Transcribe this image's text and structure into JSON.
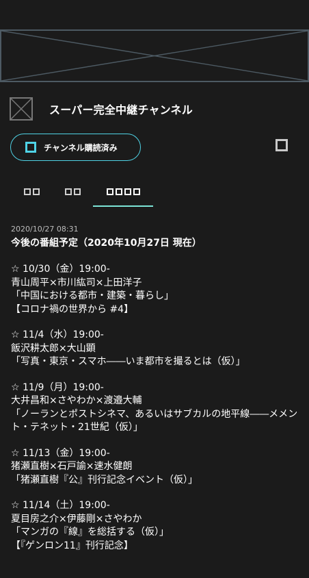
{
  "banner": {
    "icon": "placeholder-image-icon"
  },
  "channel": {
    "name": "スーパー完全中継チャンネル",
    "thumb_icon": "placeholder-image-icon"
  },
  "subscribe": {
    "label": "チャンネル購読済み",
    "icon": "checkbox-icon",
    "accent_color": "#4fd3e6"
  },
  "share": {
    "icon": "square-icon"
  },
  "tabs": [
    {
      "label": "□□",
      "active": false
    },
    {
      "label": "□□",
      "active": false
    },
    {
      "label": "□□□□",
      "active": true
    }
  ],
  "post": {
    "date": "2020/10/27 08:31",
    "heading": "今後の番組予定（2020年10月27日 現在）",
    "events": [
      {
        "lines": [
          "☆ 10/30（金）19:00-",
          "青山周平×市川紘司×上田洋子",
          "「中国における都市・建築・暮らし」",
          "【コロナ禍の世界から #4】"
        ]
      },
      {
        "lines": [
          "☆ 11/4（水）19:00-",
          "飯沢耕太郎×大山顕",
          "「写真・東京・スマホ――いま都市を撮るとは（仮）」"
        ]
      },
      {
        "lines": [
          "☆ 11/9（月）19:00-",
          "大井昌和×さやわか×渡邉大輔",
          "「ノーランとポストシネマ、あるいはサブカルの地平線――メメント・テネット・21世紀（仮）」"
        ]
      },
      {
        "lines": [
          "☆ 11/13（金）19:00-",
          "猪瀬直樹×石戸諭×速水健朗",
          "「猪瀬直樹『公』刊行記念イベント（仮）」"
        ]
      },
      {
        "lines": [
          "☆ 11/14（土）19:00-",
          "夏目房之介×伊藤剛×さやわか",
          "「マンガの『線』を総括する（仮）」",
          "【『ゲンロン11』刊行記念】"
        ]
      }
    ]
  }
}
